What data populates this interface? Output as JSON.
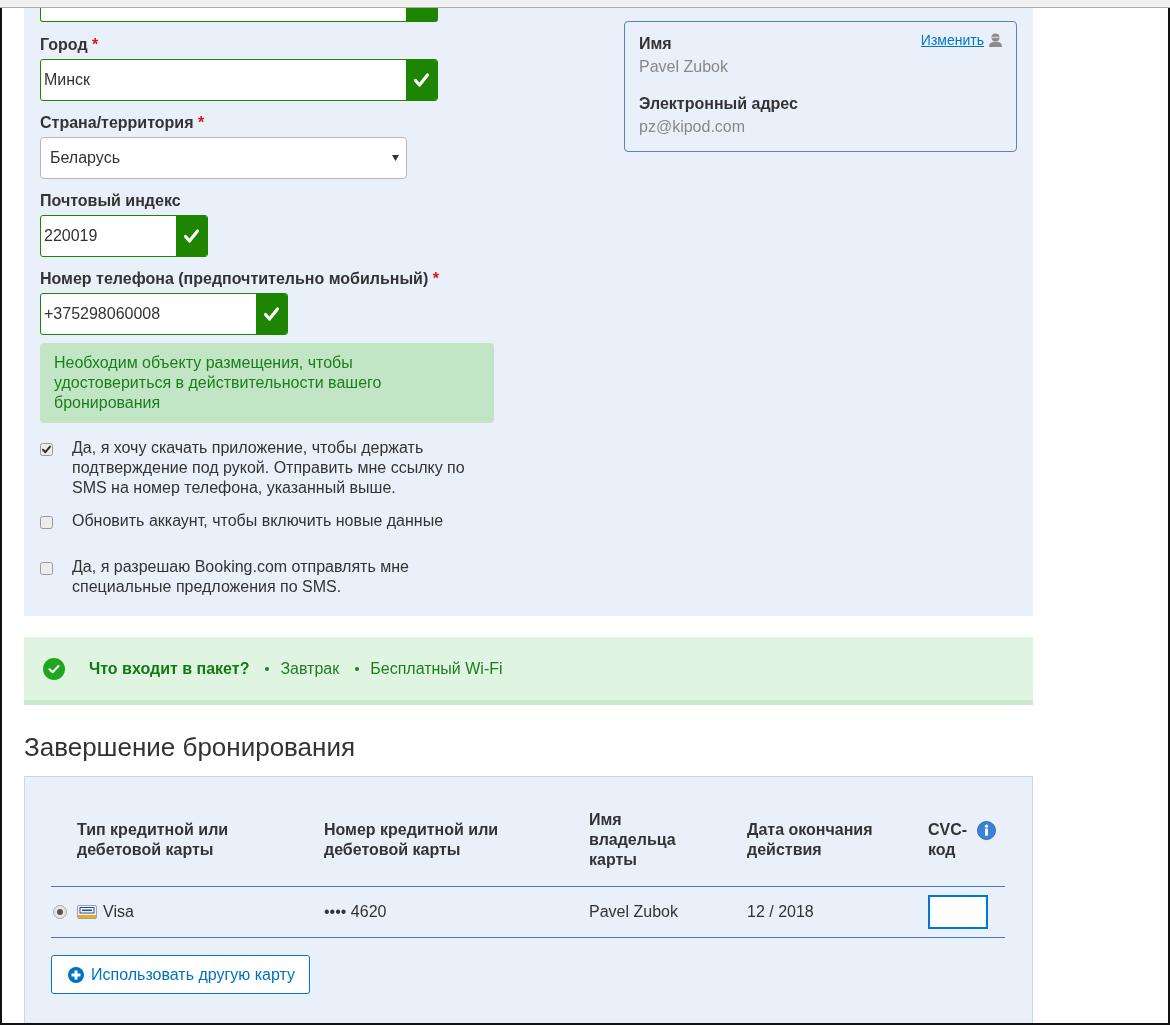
{
  "cut_off_field": {
    "valid": true
  },
  "contact_form": {
    "fields": [
      {
        "kind": "text",
        "label": "Город",
        "required_mark": "*",
        "value": "Минск",
        "valid": true
      },
      {
        "kind": "select",
        "label": "Страна/территория",
        "required_mark": "*",
        "value": "Беларусь"
      },
      {
        "kind": "text",
        "label": "Почтовый индекс",
        "value": "220019",
        "valid": true
      },
      {
        "kind": "text",
        "label": "Номер телефона (предпочтительно мобильный)",
        "required_mark": "*",
        "value": "+375298060008",
        "valid": true,
        "hint": "Необходим объекту размещения, чтобы удостовериться в действительности вашего бронирования"
      }
    ],
    "checkboxes": [
      {
        "label": "Да, я хочу скачать приложение, чтобы держать подтверждение под рукой. Отправить мне ссылку по SMS на номер телефона, указанный выше.",
        "checked": true
      },
      {
        "label": "Обновить аккаунт, чтобы включить новые данные",
        "checked": false
      },
      {
        "label": "Да, я разрешаю Booking.com отправлять мне специальные предложения по SMS.",
        "checked": false
      }
    ]
  },
  "profile_card": {
    "edit_link": "Изменить",
    "items": [
      {
        "label": "Имя",
        "value": "Pavel Zubok"
      },
      {
        "label": "Электронный адрес",
        "value": "pz@kipod.com"
      }
    ]
  },
  "package": {
    "title": "Что входит в пакет?",
    "items": [
      "Завтрак",
      "Бесплатный Wi-Fi"
    ]
  },
  "payment": {
    "heading": "Завершение бронирования",
    "table": {
      "columns": [
        {
          "label": "Тип кредитной или дебетовой карты",
          "info": false
        },
        {
          "label": "Номер кредитной или дебетовой карты",
          "info": false
        },
        {
          "label": "Имя владельца карты",
          "info": false
        },
        {
          "label": "Дата окончания действия",
          "info": false
        },
        {
          "label": "CVC-код",
          "info": true
        }
      ],
      "rows": [
        {
          "selected": true,
          "cells": [
            {
              "kind": "card",
              "text": "Visa"
            },
            {
              "kind": "text",
              "text": "•••• 4620"
            },
            {
              "kind": "text",
              "text": "Pavel Zubok"
            },
            {
              "kind": "text",
              "text": "12 / 2018"
            },
            {
              "kind": "input"
            }
          ]
        }
      ]
    },
    "add_card_button": "Использовать другую карту"
  }
}
